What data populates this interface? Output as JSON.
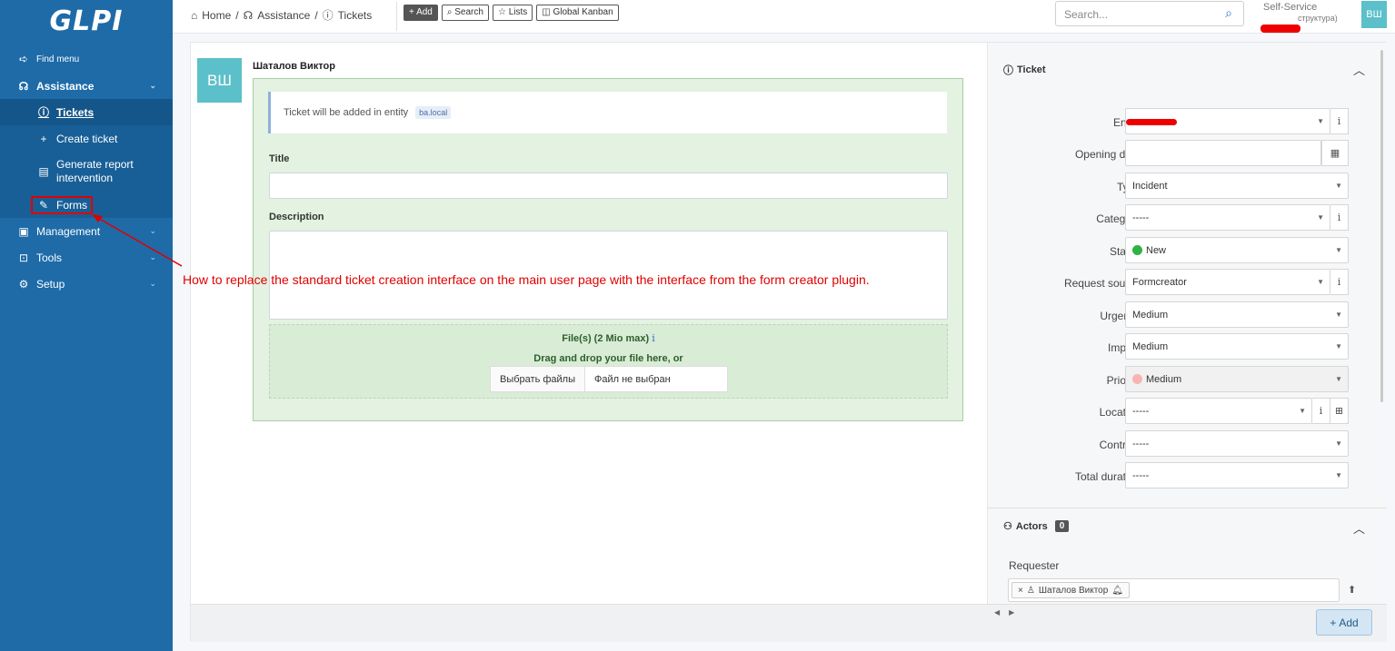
{
  "sidebar": {
    "logo": "GLPI",
    "find_menu": "Find menu",
    "assistance": "Assistance",
    "items": {
      "tickets": "Tickets",
      "create_ticket": "Create ticket",
      "generate_report": "Generate report intervention",
      "forms": "Forms"
    },
    "management": "Management",
    "tools": "Tools",
    "setup": "Setup"
  },
  "header": {
    "breadcrumb": {
      "home": "Home",
      "sep": "/",
      "assistance": "Assistance",
      "tickets": "Tickets"
    },
    "buttons": {
      "add": "+ Add",
      "search": "Search",
      "lists": "Lists",
      "kanban": "Global Kanban"
    },
    "search_placeholder": "Search...",
    "profile": {
      "name": "Self-Service",
      "entity_suffix": "структура)"
    },
    "avatar_initials": "ВШ"
  },
  "ticket_form": {
    "author_initials": "ВШ",
    "author_name": "Шаталов Виктор",
    "notice_text": "Ticket will be added in entity",
    "entity_tag": "ba.local",
    "title_label": "Title",
    "description_label": "Description",
    "files_label": "File(s) (2 Mio max)",
    "files_info": "i",
    "drop_text": "Drag and drop your file here, or",
    "choose_files": "Выбрать файлы",
    "no_file": "Файл не выбран"
  },
  "annotation": {
    "note": "How to replace the standard ticket creation interface on the main user page with the interface from the form creator plugin."
  },
  "ticket_panel": {
    "heading": "Ticket",
    "fields": {
      "entity": {
        "label": "Entity",
        "value": ""
      },
      "opening_date": {
        "label": "Opening date",
        "value": ""
      },
      "type": {
        "label": "Type",
        "value": "Incident"
      },
      "category": {
        "label": "Category",
        "value": "-----"
      },
      "status": {
        "label": "Status",
        "value": "New",
        "color": "#2fb344"
      },
      "request_source": {
        "label": "Request source",
        "value": "Formcreator"
      },
      "urgency": {
        "label": "Urgency",
        "value": "Medium"
      },
      "impact": {
        "label": "Impact",
        "value": "Medium"
      },
      "priority": {
        "label": "Priority",
        "value": "Medium",
        "color": "#f8b4b4"
      },
      "location": {
        "label": "Location",
        "value": "-----"
      },
      "contract": {
        "label": "Contract",
        "value": "-----"
      },
      "total_duration": {
        "label": "Total duration",
        "value": "-----"
      }
    }
  },
  "actors_panel": {
    "heading": "Actors",
    "count": "0",
    "requester_label": "Requester",
    "requester_name": "Шаталов Виктор"
  },
  "footer": {
    "add_label": "Add"
  },
  "colors": {
    "sidebar": "#1e6ba8",
    "card_bg": "#e3f2e1",
    "annotation": "#e00000"
  }
}
